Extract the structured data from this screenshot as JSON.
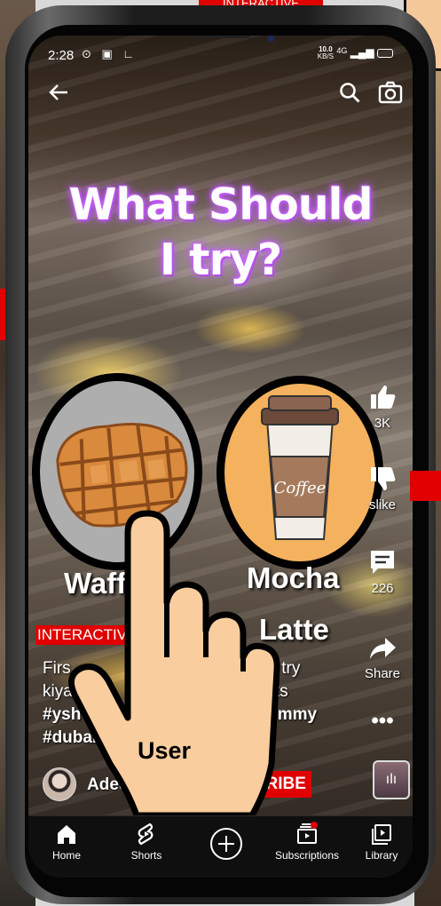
{
  "top_banner": "INTERACTIVE",
  "status_bar": {
    "time": "2:28",
    "left_icons": "⊙ ▣ ∟",
    "speed_value": "10.0",
    "speed_unit": "KB/S",
    "network": "4G"
  },
  "video": {
    "title_line1": "What Should",
    "title_line2": "I try?",
    "choices": [
      {
        "label": "Waffle"
      },
      {
        "label_line1": "Mocha",
        "label_line2": "Latte",
        "cup_text": "Coffee"
      }
    ],
    "interactive_tag": "INTERACTIVE",
    "caption_line1": "First time in Dubai Mall? Snacks try",
    "caption_line2": "kiya ... #shorts",
    "caption_tags_line1": "#yshorts #dubai #food #yummy",
    "caption_tags_line2": "#dubaishorts",
    "caption_visible_1": "Firs",
    "caption_visible_1b": "ks try",
    "caption_visible_2": "kiya",
    "caption_visible_2b": "orts",
    "caption_visible_3": "#ysh",
    "caption_visible_3b": "#yummy",
    "caption_visible_4": "#dubais"
  },
  "actions": {
    "like_count": "3K",
    "dislike_label": "slike",
    "comments_count": "226",
    "share_label": "Share"
  },
  "channel": {
    "name": "Adeeba Naaz",
    "subscribe_label": "SUBSCRIBE"
  },
  "overlay": {
    "user_label": "User"
  },
  "bottom_nav": [
    {
      "label": "Home",
      "icon": "home-icon"
    },
    {
      "label": "Shorts",
      "icon": "shorts-icon"
    },
    {
      "label": "",
      "icon": "create-icon"
    },
    {
      "label": "Subscriptions",
      "icon": "subscriptions-icon"
    },
    {
      "label": "Library",
      "icon": "library-icon"
    }
  ],
  "colors": {
    "accent_red": "#e00000",
    "title_glow": "#b84dff",
    "coffee_bg": "#f4b15e"
  }
}
